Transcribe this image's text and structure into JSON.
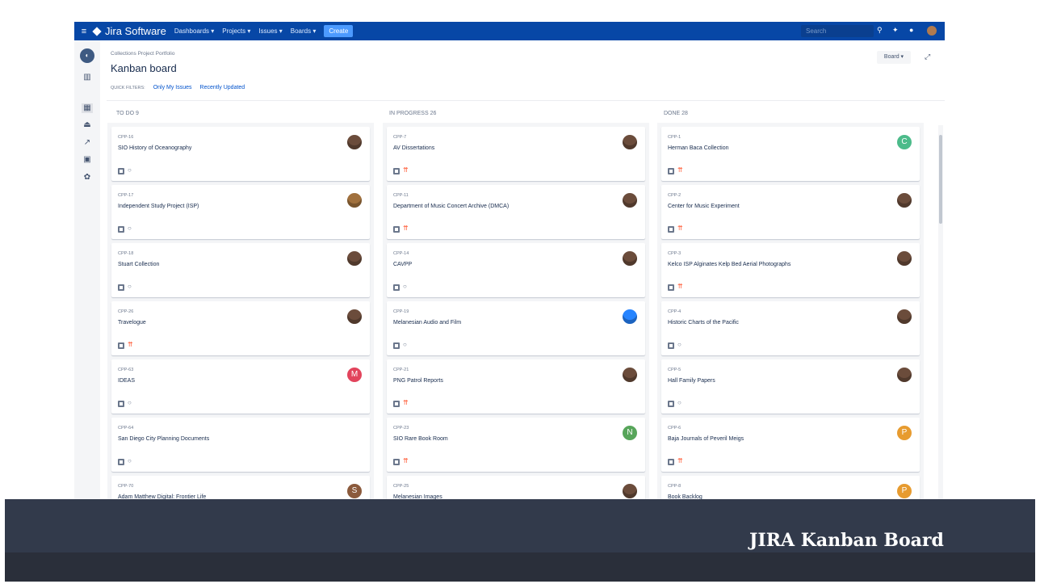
{
  "nav": {
    "product": "Jira Software",
    "items": [
      "Dashboards ▾",
      "Projects ▾",
      "Issues ▾",
      "Boards ▾"
    ],
    "create_label": "Create",
    "search_placeholder": "Search"
  },
  "header": {
    "breadcrumb": "Collections Project Portfolio",
    "title": "Kanban board",
    "quick_filters_label": "QUICK FILTERS:",
    "filters": [
      "Only My Issues",
      "Recently Updated"
    ],
    "board_button": "Board ▾"
  },
  "columns": [
    {
      "title": "TO DO 9",
      "cards": [
        {
          "key": "CPP-16",
          "summary": "SIO History of Oceanography",
          "priority": "low",
          "avatar": {
            "type": "photo",
            "letter": "",
            "color": "#6b4c3b"
          }
        },
        {
          "key": "CPP-17",
          "summary": "Independent Study Project (ISP)",
          "priority": "low",
          "avatar": {
            "type": "photo",
            "letter": "",
            "color": "#a0703d"
          }
        },
        {
          "key": "CPP-18",
          "summary": "Stuart Collection",
          "priority": "low",
          "avatar": {
            "type": "photo",
            "letter": "",
            "color": "#6b4c3b"
          }
        },
        {
          "key": "CPP-26",
          "summary": "Travelogue",
          "priority": "high",
          "avatar": {
            "type": "photo",
            "letter": "",
            "color": "#6b4c3b"
          }
        },
        {
          "key": "CPP-63",
          "summary": "IDEAS",
          "priority": "low",
          "avatar": {
            "type": "letter",
            "letter": "M",
            "color": "#e2445c"
          }
        },
        {
          "key": "CPP-64",
          "summary": "San Diego City Planning Documents",
          "priority": "low",
          "avatar": null
        },
        {
          "key": "CPP-70",
          "summary": "Adam Matthew Digital: Frontier Life",
          "priority": "low",
          "avatar": {
            "type": "letter",
            "letter": "S",
            "color": "#8b5a3c"
          }
        }
      ]
    },
    {
      "title": "IN PROGRESS 26",
      "cards": [
        {
          "key": "CPP-7",
          "summary": "AV Dissertations",
          "priority": "high",
          "avatar": {
            "type": "photo",
            "letter": "",
            "color": "#6b4c3b"
          }
        },
        {
          "key": "CPP-11",
          "summary": "Department of Music Concert Archive (DMCA)",
          "priority": "high",
          "avatar": {
            "type": "photo",
            "letter": "",
            "color": "#6b4c3b"
          }
        },
        {
          "key": "CPP-14",
          "summary": "CAVPP",
          "priority": "low",
          "avatar": {
            "type": "photo",
            "letter": "",
            "color": "#6b4c3b"
          }
        },
        {
          "key": "CPP-19",
          "summary": "Melanesian Audio and Film",
          "priority": "low",
          "avatar": {
            "type": "photo",
            "letter": "",
            "color": "#2684ff"
          }
        },
        {
          "key": "CPP-21",
          "summary": "PNG Patrol Reports",
          "priority": "high",
          "avatar": {
            "type": "photo",
            "letter": "",
            "color": "#6b4c3b"
          }
        },
        {
          "key": "CPP-23",
          "summary": "SIO Rare Book Room",
          "priority": "high",
          "avatar": {
            "type": "letter",
            "letter": "N",
            "color": "#57a55a"
          }
        },
        {
          "key": "CPP-25",
          "summary": "Melanesian Images",
          "priority": "high",
          "avatar": {
            "type": "photo",
            "letter": "",
            "color": "#6b4c3b"
          }
        }
      ]
    },
    {
      "title": "DONE 28",
      "cards": [
        {
          "key": "CPP-1",
          "summary": "Herman Baca Collection",
          "priority": "high",
          "avatar": {
            "type": "letter",
            "letter": "C",
            "color": "#4cbb8a"
          }
        },
        {
          "key": "CPP-2",
          "summary": "Center for Music Experiment",
          "priority": "high",
          "avatar": {
            "type": "photo",
            "letter": "",
            "color": "#6b4c3b"
          }
        },
        {
          "key": "CPP-3",
          "summary": "Kelco ISP Alginates Kelp Bed Aerial Photographs",
          "priority": "high",
          "avatar": {
            "type": "photo",
            "letter": "",
            "color": "#6b4c3b"
          }
        },
        {
          "key": "CPP-4",
          "summary": "Historic Charts of the Pacific",
          "priority": "low",
          "avatar": {
            "type": "photo",
            "letter": "",
            "color": "#6b4c3b"
          }
        },
        {
          "key": "CPP-5",
          "summary": "Hall Family Papers",
          "priority": "low",
          "avatar": {
            "type": "photo",
            "letter": "",
            "color": "#6b4c3b"
          }
        },
        {
          "key": "CPP-6",
          "summary": "Baja Journals of Peveril Meigs",
          "priority": "high",
          "avatar": {
            "type": "letter",
            "letter": "P",
            "color": "#e79b2f"
          }
        },
        {
          "key": "CPP-8",
          "summary": "Book Backlog",
          "priority": "low",
          "avatar": {
            "type": "letter",
            "letter": "P",
            "color": "#e79b2f"
          }
        }
      ]
    }
  ],
  "caption": "JIRA Kanban Board"
}
